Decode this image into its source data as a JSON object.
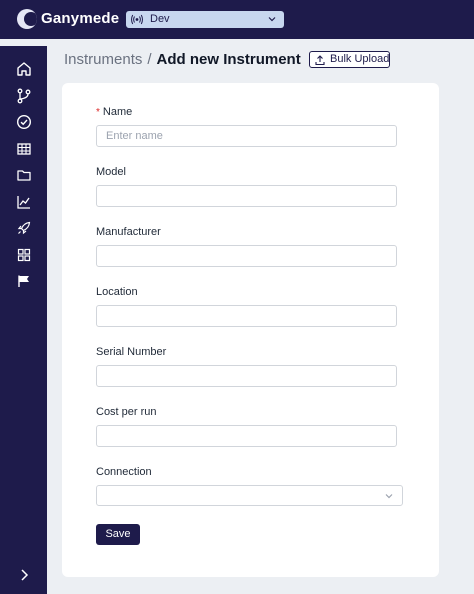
{
  "app": {
    "brand": "Ganymede",
    "environment": "Dev"
  },
  "sidebar": {
    "items": [
      {
        "icon": "home-icon"
      },
      {
        "icon": "git-branch-icon"
      },
      {
        "icon": "check-circle-icon"
      },
      {
        "icon": "table-icon"
      },
      {
        "icon": "folder-icon"
      },
      {
        "icon": "chart-icon"
      },
      {
        "icon": "rocket-icon"
      },
      {
        "icon": "grid-icon"
      },
      {
        "icon": "flag-icon"
      }
    ],
    "expand_icon": "chevron-right-icon"
  },
  "breadcrumb": {
    "parent": "Instruments",
    "separator": "/",
    "current": "Add new Instrument"
  },
  "toolbar": {
    "bulk_upload_label": "Bulk Upload"
  },
  "form": {
    "name": {
      "label": "Name",
      "required_marker": "*",
      "placeholder": "Enter name",
      "value": ""
    },
    "model": {
      "label": "Model",
      "value": ""
    },
    "manufacturer": {
      "label": "Manufacturer",
      "value": ""
    },
    "location": {
      "label": "Location",
      "value": ""
    },
    "serial_number": {
      "label": "Serial Number",
      "value": ""
    },
    "cost_per_run": {
      "label": "Cost per run",
      "value": ""
    },
    "connection": {
      "label": "Connection",
      "value": ""
    },
    "save_label": "Save"
  },
  "colors": {
    "primary": "#1e1b4b",
    "env_select_bg": "#c7d7ef",
    "page_bg": "#eceff3",
    "required": "#dc2626"
  }
}
